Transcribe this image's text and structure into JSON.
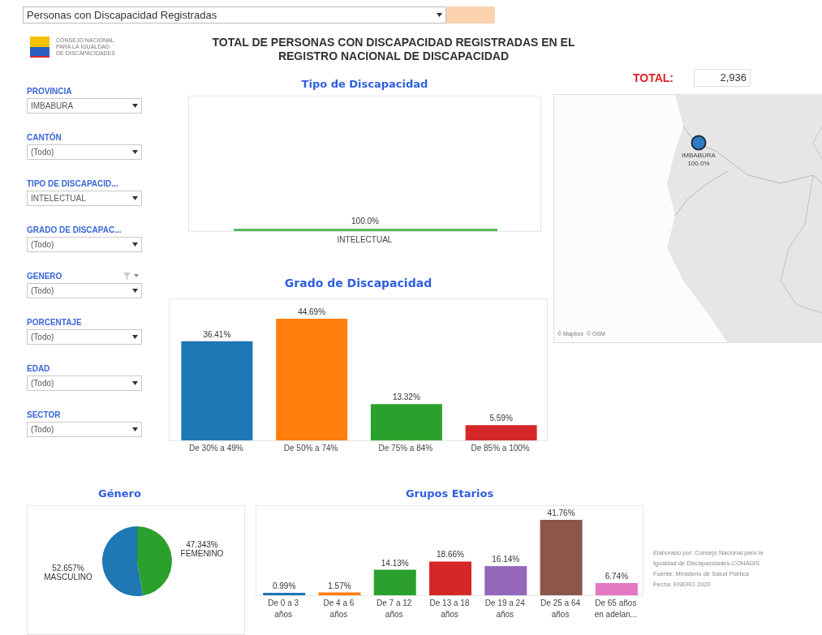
{
  "report_selector": {
    "value": "Personas con Discapacidad Registradas"
  },
  "logo": {
    "lines": [
      "CONSEJO NACIONAL",
      "PARA LA IGUALDAD",
      "DE DISCAPACIDADES"
    ]
  },
  "title": "TOTAL DE PERSONAS CON DISCAPACIDAD REGISTRADAS EN EL REGISTRO NACIONAL DE DISCAPACIDAD",
  "filters": [
    {
      "label": "PROVINCIA",
      "value": "IMBABURA",
      "filter_menu": false
    },
    {
      "label": "CANTÓN",
      "value": "(Todo)",
      "filter_menu": false
    },
    {
      "label": "TIPO DE DISCAPACID...",
      "value": "INTELECTUAL",
      "filter_menu": false
    },
    {
      "label": "GRADO DE DISCAPAC...",
      "value": "(Todo)",
      "filter_menu": false
    },
    {
      "label": "GENERO",
      "value": "(Todo)",
      "filter_menu": true
    },
    {
      "label": "PORCENTAJE",
      "value": "(Todo)",
      "filter_menu": false
    },
    {
      "label": "EDAD",
      "value": "(Todo)",
      "filter_menu": false
    },
    {
      "label": "SECTOR",
      "value": "(Todo)",
      "filter_menu": false
    }
  ],
  "total": {
    "label": "TOTAL:",
    "value": "2,936"
  },
  "map": {
    "kind": "picture",
    "marker": {
      "label": "IMBABURA",
      "value": "100.0%",
      "color": "#2f7bc0"
    },
    "attribution": "© Mapbox  © OSM"
  },
  "tipo": {
    "title": "Tipo de Discapacidad",
    "bars": [
      {
        "category": "INTELECTUAL",
        "value_label": "100.0%",
        "level": 1,
        "color": "#5cb85c"
      }
    ]
  },
  "grado": {
    "chart_data": {
      "type": "bar",
      "title": "Grado de Discapacidad",
      "categories": [
        "De 30% a 49%",
        "De 50% a 74%",
        "De 75% a 84%",
        "De 85% a 100%"
      ],
      "values": [
        36.41,
        44.69,
        13.32,
        5.59
      ],
      "colors": [
        "#1f77b4",
        "#ff7f0e",
        "#2ca02c",
        "#d62728"
      ],
      "value_labels": [
        "36.41%",
        "44.69%",
        "13.32%",
        "5.59%"
      ]
    }
  },
  "genero": {
    "chart_data": {
      "type": "pie",
      "title": "Género",
      "categories": [
        "MASCULINO",
        "FEMENINO"
      ],
      "values": [
        52.657,
        47.343
      ],
      "colors": [
        "#1f77b4",
        "#2ca02c"
      ],
      "value_labels": [
        "52.657%",
        "47.343%"
      ]
    }
  },
  "grupos": {
    "chart_data": {
      "type": "bar",
      "title": "Grupos Etarios",
      "categories": [
        "De 0 a 3 años",
        "De 4 a 6 años",
        "De 7 a 12 años",
        "De 13 a 18 años",
        "De 19 a 24 años",
        "De 25 a 64 años",
        "De 65 años en adelan..."
      ],
      "values": [
        0.99,
        1.57,
        14.13,
        18.66,
        16.14,
        41.76,
        6.74
      ],
      "colors": [
        "#1f77b4",
        "#ff7f0e",
        "#2ca02c",
        "#d62728",
        "#9467bd",
        "#8c564b",
        "#e377c2"
      ],
      "value_labels": [
        "0.99%",
        "1.57%",
        "14.13%",
        "18.66%",
        "16.14%",
        "41.76%",
        "6.74%"
      ]
    }
  },
  "footer": [
    "Elaborado por: Consejo Nacional para la",
    "Igualdad de Discapacidades-CONADIS",
    "Fuente: Ministerio de Salud Pública",
    "Fecha: ENERO 2020"
  ]
}
